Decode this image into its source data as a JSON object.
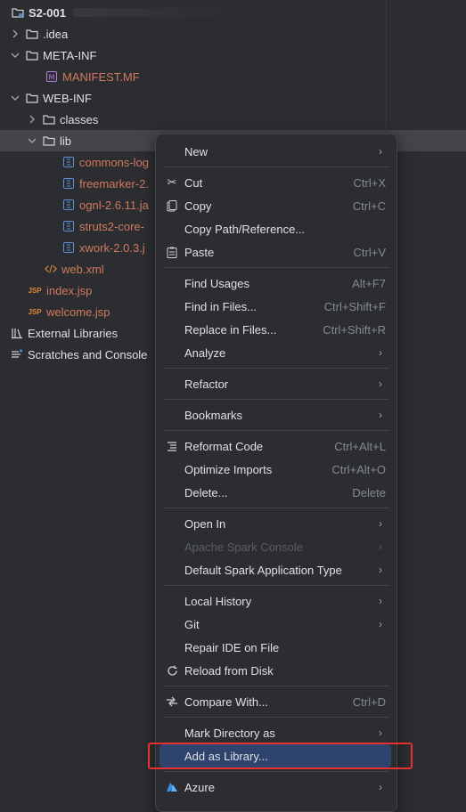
{
  "tree": {
    "root": "S2-001",
    "items": [
      {
        "label": ".idea"
      },
      {
        "label": "META-INF"
      },
      {
        "label": "MANIFEST.MF"
      },
      {
        "label": "WEB-INF"
      },
      {
        "label": "classes"
      },
      {
        "label": "lib"
      },
      {
        "label": "commons-log"
      },
      {
        "label": "freemarker-2."
      },
      {
        "label": "ognl-2.6.11.ja"
      },
      {
        "label": "struts2-core-"
      },
      {
        "label": "xwork-2.0.3.j"
      },
      {
        "label": "web.xml"
      },
      {
        "label": "index.jsp"
      },
      {
        "label": "welcome.jsp"
      },
      {
        "label": "External Libraries"
      },
      {
        "label": "Scratches and Console"
      }
    ]
  },
  "menu": {
    "items": [
      {
        "label": "New"
      },
      {
        "label": "Cut",
        "shortcut": "Ctrl+X"
      },
      {
        "label": "Copy",
        "shortcut": "Ctrl+C"
      },
      {
        "label": "Copy Path/Reference..."
      },
      {
        "label": "Paste",
        "shortcut": "Ctrl+V"
      },
      {
        "label": "Find Usages",
        "shortcut": "Alt+F7"
      },
      {
        "label": "Find in Files...",
        "shortcut": "Ctrl+Shift+F"
      },
      {
        "label": "Replace in Files...",
        "shortcut": "Ctrl+Shift+R"
      },
      {
        "label": "Analyze"
      },
      {
        "label": "Refactor"
      },
      {
        "label": "Bookmarks"
      },
      {
        "label": "Reformat Code",
        "shortcut": "Ctrl+Alt+L"
      },
      {
        "label": "Optimize Imports",
        "shortcut": "Ctrl+Alt+O"
      },
      {
        "label": "Delete...",
        "shortcut": "Delete"
      },
      {
        "label": "Open In"
      },
      {
        "label": "Apache Spark Console"
      },
      {
        "label": "Default Spark Application Type"
      },
      {
        "label": "Local History"
      },
      {
        "label": "Git"
      },
      {
        "label": "Repair IDE on File"
      },
      {
        "label": "Reload from Disk"
      },
      {
        "label": "Compare With...",
        "shortcut": "Ctrl+D"
      },
      {
        "label": "Mark Directory as"
      },
      {
        "label": "Add as Library..."
      },
      {
        "label": "Azure"
      }
    ]
  },
  "colors": {
    "background": "#2b2d30",
    "highlight": "#2e436e",
    "orange_text": "#d2795f",
    "annotation_box": "#e5312f"
  }
}
